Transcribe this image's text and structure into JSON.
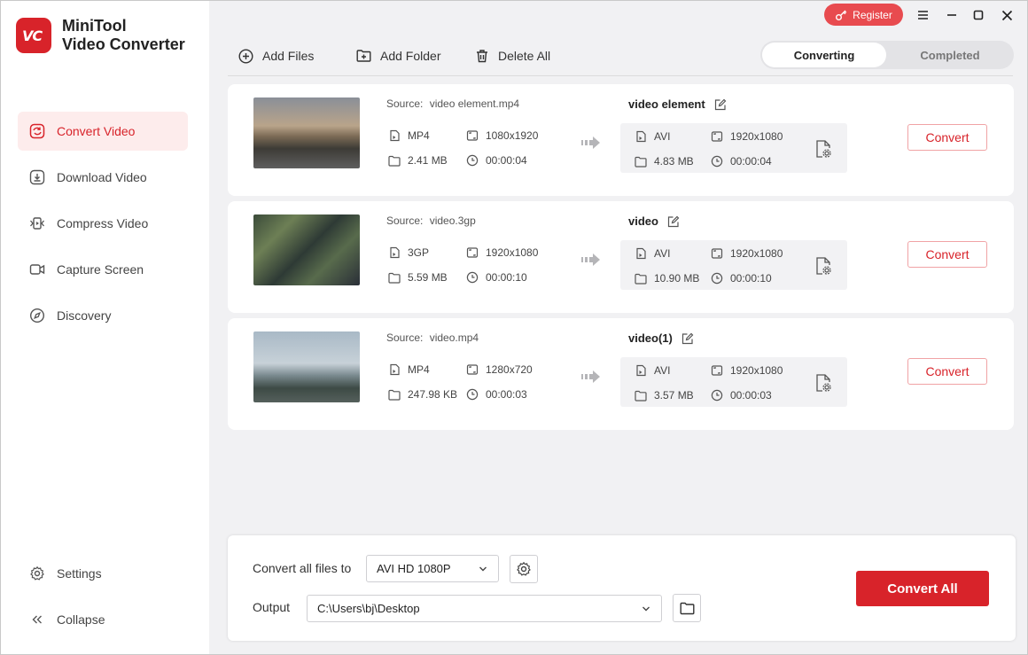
{
  "app": {
    "title_line1": "MiniTool",
    "title_line2": "Video Converter",
    "logo_text": "vc"
  },
  "titlebar": {
    "register_label": "Register"
  },
  "sidebar": {
    "items": [
      {
        "label": "Convert Video",
        "icon": "convert-icon",
        "active": true
      },
      {
        "label": "Download Video",
        "icon": "download-icon"
      },
      {
        "label": "Compress Video",
        "icon": "compress-icon"
      },
      {
        "label": "Capture Screen",
        "icon": "camera-icon"
      },
      {
        "label": "Discovery",
        "icon": "compass-icon"
      }
    ],
    "bottom": [
      {
        "label": "Settings",
        "icon": "gear-icon"
      },
      {
        "label": "Collapse",
        "icon": "collapse-icon"
      }
    ]
  },
  "toolbar": {
    "add_files": "Add Files",
    "add_folder": "Add Folder",
    "delete_all": "Delete All"
  },
  "tabs": {
    "converting": "Converting",
    "completed": "Completed"
  },
  "tasks": [
    {
      "source_label": "Source:",
      "source_file": "video element.mp4",
      "in_format": "MP4",
      "in_resolution": "1080x1920",
      "in_size": "2.41 MB",
      "in_duration": "00:00:04",
      "out_name": "video element",
      "out_format": "AVI",
      "out_resolution": "1920x1080",
      "out_size": "4.83 MB",
      "out_duration": "00:00:04",
      "convert_label": "Convert"
    },
    {
      "source_label": "Source:",
      "source_file": "video.3gp",
      "in_format": "3GP",
      "in_resolution": "1920x1080",
      "in_size": "5.59 MB",
      "in_duration": "00:00:10",
      "out_name": "video",
      "out_format": "AVI",
      "out_resolution": "1920x1080",
      "out_size": "10.90 MB",
      "out_duration": "00:00:10",
      "convert_label": "Convert"
    },
    {
      "source_label": "Source:",
      "source_file": "video.mp4",
      "in_format": "MP4",
      "in_resolution": "1280x720",
      "in_size": "247.98 KB",
      "in_duration": "00:00:03",
      "out_name": "video(1)",
      "out_format": "AVI",
      "out_resolution": "1920x1080",
      "out_size": "3.57 MB",
      "out_duration": "00:00:03",
      "convert_label": "Convert"
    }
  ],
  "footer": {
    "convert_all_files_label": "Convert all files to",
    "format_value": "AVI HD 1080P",
    "output_label": "Output",
    "output_path": "C:\\Users\\bj\\Desktop",
    "convert_all_label": "Convert All"
  },
  "colors": {
    "accent": "#d8232a",
    "register": "#e84b4f",
    "active_bg": "#fdecec"
  }
}
